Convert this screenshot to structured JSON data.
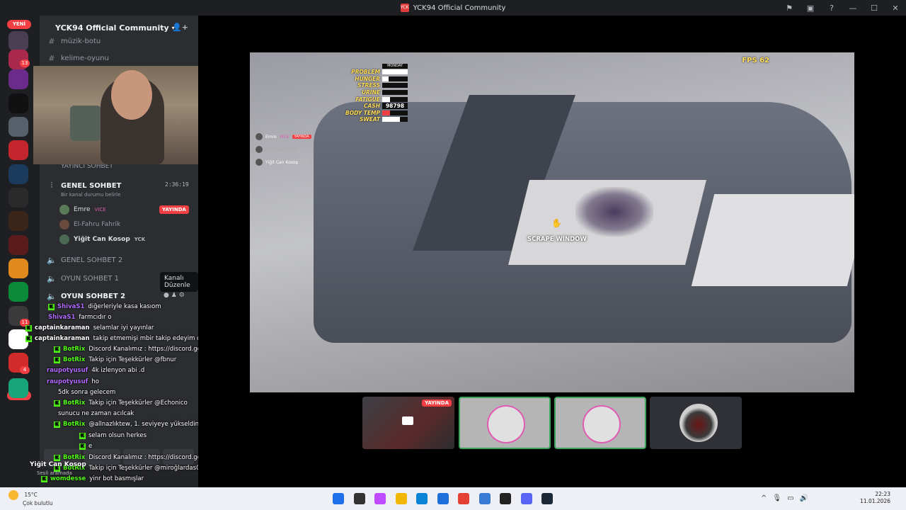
{
  "window": {
    "title": "YCK94 Official Community",
    "badge": "YCK",
    "controls": [
      "⚑",
      "▣",
      "?",
      "—",
      "☐",
      "✕"
    ]
  },
  "rail": {
    "new_label": "YENİ",
    "new_label_bottom": "YENİ",
    "badges": [
      "13",
      "11",
      "4"
    ],
    "servers": [
      {
        "color": "#4a3f52"
      },
      {
        "color": "#a8294b"
      },
      {
        "color": "#6b2b8a"
      },
      {
        "color": "#111111"
      },
      {
        "color": "#55606b"
      },
      {
        "color": "#c4262e"
      },
      {
        "color": "#1b3a5c"
      },
      {
        "color": "#2a2a2a"
      },
      {
        "color": "#3b2418"
      },
      {
        "color": "#5a1b1b"
      },
      {
        "color": "#e08a1e"
      },
      {
        "color": "#0b8a3a"
      },
      {
        "color": "#3a3a3a"
      },
      {
        "color": "#ffffff"
      },
      {
        "color": "#d12b2b"
      },
      {
        "color": "#18a57a"
      }
    ]
  },
  "sidebar": {
    "server_name": "YCK94 Official Community",
    "channels_top": [
      {
        "name": "müzik-botu",
        "icon": "#"
      },
      {
        "name": "kelime-oyunu",
        "icon": "#"
      }
    ],
    "category": "YAYINCI SOHBET",
    "active_voice": {
      "name": "GENEL SOHBET",
      "timer": "2:36:19",
      "status_placeholder": "Bir kanal durumu belirle"
    },
    "members": [
      {
        "name": "Emre",
        "tag": "VICE",
        "live": "YAYINDA"
      },
      {
        "name": "El-Fahru Fahrik",
        "tag": "",
        "live": ""
      },
      {
        "name": "Yiğit Can Kosop",
        "tag": "YCK",
        "live": ""
      }
    ],
    "voice_channels": [
      {
        "name": "GENEL SOHBET 2"
      },
      {
        "name": "OYUN SOHBET 1"
      },
      {
        "name": "OYUN SOHBET 2"
      }
    ],
    "tooltip": "Kanalı Düzenle",
    "user_panel": {
      "name": "Yiğit Can Kosop",
      "status": "Sesli aramada"
    }
  },
  "chat": [
    {
      "user": "ShivaS1",
      "user_color": "#b36bff",
      "msg": "diğerleriyle kasa kasıom",
      "kick": true
    },
    {
      "user": "ShivaS1",
      "user_color": "#b36bff",
      "msg": "farmcıdır o",
      "kick": false
    },
    {
      "user": "captainkaraman",
      "user_color": "#ffffff",
      "msg": "selamlar iyi yayınlar",
      "kick": true
    },
    {
      "user": "captainkaraman",
      "user_color": "#ffffff",
      "msg": "takip etmemişi mbir takip edeyim dedim",
      "kick": true
    },
    {
      "user": "BotRix",
      "user_color": "#53fc18",
      "msg": "Discord Kanalımız : https://discord.gg/xeB9JejQHk",
      "kick": true
    },
    {
      "user": "BotRix",
      "user_color": "#53fc18",
      "msg": "Takip için Teşekkürler @fbnur",
      "kick": true
    },
    {
      "user": "raupotyusuf",
      "user_color": "#b36bff",
      "msg": "4k izlenyon abi .d",
      "kick": false
    },
    {
      "user": "raupotyusuf",
      "user_color": "#b36bff",
      "msg": "ho",
      "kick": false
    },
    {
      "user": "",
      "user_color": "#ffffff",
      "msg": "5dk sonra gelecem",
      "kick": false
    },
    {
      "user": "BotRix",
      "user_color": "#53fc18",
      "msg": "Takip için Teşekkürler @Echonico",
      "kick": true
    },
    {
      "user": "",
      "user_color": "#ffffff",
      "msg": "sunucu ne zaman acılcak",
      "kick": false
    },
    {
      "user": "BotRix",
      "user_color": "#53fc18",
      "msg": "@allnazlıktew, 1. seviyeye yükseldin",
      "kick": true
    },
    {
      "user": "",
      "user_color": "#ffffff",
      "msg": "selam olsun herkes",
      "kick": true
    },
    {
      "user": "",
      "user_color": "#ffffff",
      "msg": "e",
      "kick": true
    },
    {
      "user": "BotRix",
      "user_color": "#53fc18",
      "msg": "Discord Kanalımız : https://discord.gg/xeB9JejQHk",
      "kick": true
    },
    {
      "user": "BotRix",
      "user_color": "#53fc18",
      "msg": "Takip için Teşekkürler @miroğlardas06",
      "kick": true
    },
    {
      "user": "womdesse",
      "user_color": "#53fc18",
      "msg": "yinr bot basmışlar",
      "kick": true
    }
  ],
  "game": {
    "fps": "FPS 62",
    "day": "MONDAY",
    "stats": [
      {
        "label": "PROBLEM",
        "level": 1.0
      },
      {
        "label": "HUNGER",
        "level": 0.25
      },
      {
        "label": "STRESS",
        "level": 0.0
      },
      {
        "label": "URINE",
        "level": 0.0
      },
      {
        "label": "FATIGUE",
        "level": 0.3
      },
      {
        "label": "CASH",
        "value": "98798"
      },
      {
        "label": "BODY TEMP",
        "level": 0.3,
        "color": "#f23f43"
      },
      {
        "label": "SWEAT",
        "level": 0.7
      }
    ],
    "prompt": "SCRAPE WINDOW",
    "voice_overlay": [
      {
        "name": "Emre",
        "tag": "VICE",
        "live": "YAYINDA"
      },
      {
        "name": "El-Fahru Fahrik",
        "tag": "",
        "live": ""
      },
      {
        "name": "Yiğit Can Kosop",
        "tag": "YCK",
        "live": ""
      }
    ]
  },
  "thumbnails": [
    {
      "type": "stream",
      "live": "YAYINDA"
    },
    {
      "type": "avatar"
    },
    {
      "type": "avatar"
    },
    {
      "type": "car"
    }
  ],
  "taskbar": {
    "temp": "15°C",
    "weather": "Çok bulutlu",
    "notif": "2",
    "time": "22:23",
    "date": "11.01.2026",
    "apps": [
      "#1f6feb",
      "#333333",
      "#c04aff",
      "#f2b705",
      "#0a84d6",
      "#1e6fd9",
      "#e44134",
      "#3a7bd5",
      "#222222",
      "#5865f2",
      "#1b2838"
    ]
  }
}
